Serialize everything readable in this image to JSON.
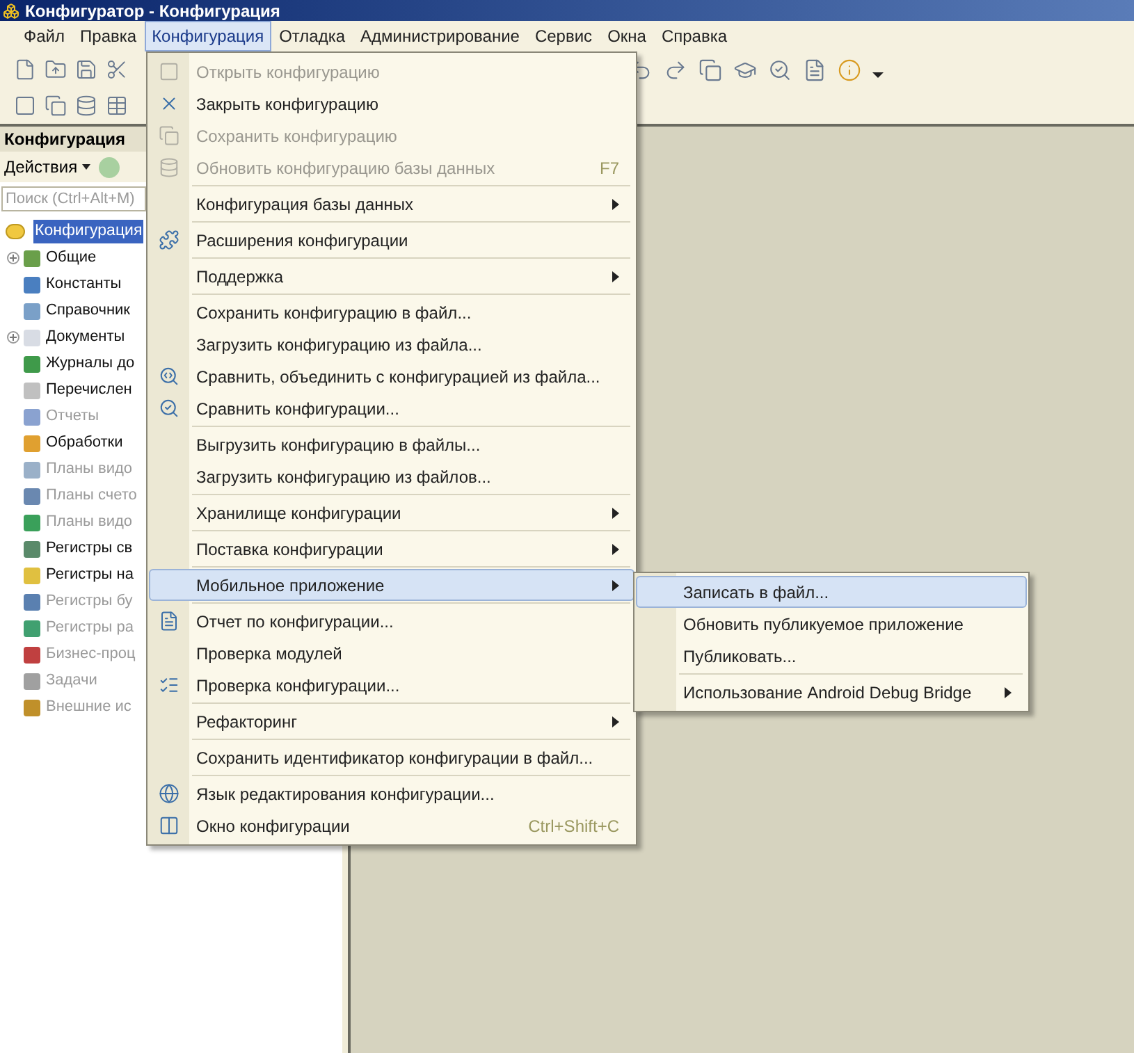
{
  "window": {
    "title": "Конфигуратор - Конфигурация"
  },
  "menubar": [
    {
      "label": "Файл",
      "selected": false
    },
    {
      "label": "Правка",
      "selected": false
    },
    {
      "label": "Конфигурация",
      "selected": true
    },
    {
      "label": "Отладка",
      "selected": false
    },
    {
      "label": "Администрирование",
      "selected": false
    },
    {
      "label": "Сервис",
      "selected": false
    },
    {
      "label": "Окна",
      "selected": false
    },
    {
      "label": "Справка",
      "selected": false
    }
  ],
  "panel": {
    "title": "Конфигурация",
    "actions": "Действия",
    "search": {
      "placeholder": "Поиск (Ctrl+Alt+M)"
    },
    "tree": [
      {
        "label": "Конфигурация",
        "selected": true,
        "children": [
          {
            "label": "Общие",
            "selected": false,
            "disabled": false,
            "expandable": true
          },
          {
            "label": "Константы",
            "selected": false,
            "disabled": false,
            "expandable": false
          },
          {
            "label": "Справочник",
            "selected": false,
            "disabled": false,
            "expandable": false
          },
          {
            "label": "Документы",
            "selected": false,
            "disabled": false,
            "expandable": true
          },
          {
            "label": "Журналы до",
            "selected": false,
            "disabled": false,
            "expandable": false
          },
          {
            "label": "Перечислен",
            "selected": false,
            "disabled": false,
            "expandable": false
          },
          {
            "label": "Отчеты",
            "selected": false,
            "disabled": true,
            "expandable": false
          },
          {
            "label": "Обработки",
            "selected": false,
            "disabled": false,
            "expandable": false
          },
          {
            "label": "Планы видо",
            "selected": false,
            "disabled": true,
            "expandable": false
          },
          {
            "label": "Планы счето",
            "selected": false,
            "disabled": true,
            "expandable": false
          },
          {
            "label": "Планы видо",
            "selected": false,
            "disabled": true,
            "expandable": false
          },
          {
            "label": "Регистры св",
            "selected": false,
            "disabled": false,
            "expandable": false
          },
          {
            "label": "Регистры на",
            "selected": false,
            "disabled": false,
            "expandable": false
          },
          {
            "label": "Регистры бу",
            "selected": false,
            "disabled": true,
            "expandable": false
          },
          {
            "label": "Регистры ра",
            "selected": false,
            "disabled": true,
            "expandable": false
          },
          {
            "label": "Бизнес-проц",
            "selected": false,
            "disabled": true,
            "expandable": false
          },
          {
            "label": "Задачи",
            "selected": false,
            "disabled": true,
            "expandable": false
          },
          {
            "label": "Внешние ис",
            "selected": false,
            "disabled": true,
            "expandable": false
          }
        ]
      }
    ]
  },
  "menu": {
    "groups": [
      [
        {
          "label": "Открыть конфигурацию",
          "disabled": true,
          "submenu": false,
          "selected": false
        },
        {
          "label": "Закрыть конфигурацию",
          "disabled": false,
          "submenu": false,
          "selected": false
        },
        {
          "label": "Сохранить конфигурацию",
          "disabled": true,
          "submenu": false,
          "selected": false
        },
        {
          "label": "Обновить конфигурацию базы данных",
          "shortcut": "F7",
          "disabled": true,
          "submenu": false,
          "selected": false
        }
      ],
      [
        {
          "label": "Конфигурация базы данных",
          "disabled": false,
          "submenu": true,
          "selected": false
        }
      ],
      [
        {
          "label": "Расширения конфигурации",
          "disabled": false,
          "submenu": false,
          "selected": false
        }
      ],
      [
        {
          "label": "Поддержка",
          "disabled": false,
          "submenu": true,
          "selected": false
        }
      ],
      [
        {
          "label": "Сохранить конфигурацию в файл...",
          "disabled": false,
          "submenu": false,
          "selected": false
        },
        {
          "label": "Загрузить конфигурацию из файла...",
          "disabled": false,
          "submenu": false,
          "selected": false
        },
        {
          "label": "Сравнить, объединить с конфигурацией из файла...",
          "disabled": false,
          "submenu": false,
          "selected": false
        },
        {
          "label": "Сравнить конфигурации...",
          "disabled": false,
          "submenu": false,
          "selected": false
        }
      ],
      [
        {
          "label": "Выгрузить конфигурацию в файлы...",
          "disabled": false,
          "submenu": false,
          "selected": false
        },
        {
          "label": "Загрузить конфигурацию из файлов...",
          "disabled": false,
          "submenu": false,
          "selected": false
        }
      ],
      [
        {
          "label": "Хранилище конфигурации",
          "disabled": false,
          "submenu": true,
          "selected": false
        }
      ],
      [
        {
          "label": "Поставка конфигурации",
          "disabled": false,
          "submenu": true,
          "selected": false
        }
      ],
      [
        {
          "label": "Мобильное приложение",
          "disabled": false,
          "submenu": true,
          "selected": true
        }
      ],
      [
        {
          "label": "Отчет по конфигурации...",
          "disabled": false,
          "submenu": false,
          "selected": false
        },
        {
          "label": "Проверка модулей",
          "disabled": false,
          "submenu": false,
          "selected": false
        },
        {
          "label": "Проверка конфигурации...",
          "disabled": false,
          "submenu": false,
          "selected": false
        }
      ],
      [
        {
          "label": "Рефакторинг",
          "disabled": false,
          "submenu": true,
          "selected": false
        }
      ],
      [
        {
          "label": "Сохранить идентификатор конфигурации в файл...",
          "disabled": false,
          "submenu": false,
          "selected": false
        }
      ],
      [
        {
          "label": "Язык редактирования конфигурации...",
          "disabled": false,
          "submenu": false,
          "selected": false
        },
        {
          "label": "Окно конфигурации",
          "shortcut": "Ctrl+Shift+C",
          "disabled": false,
          "submenu": false,
          "selected": false
        }
      ]
    ]
  },
  "submenu": {
    "groups": [
      [
        {
          "label": "Записать в файл...",
          "disabled": false,
          "submenu": false,
          "selected": true
        },
        {
          "label": "Обновить публикуемое приложение",
          "disabled": false,
          "submenu": false,
          "selected": false
        },
        {
          "label": "Публиковать...",
          "disabled": false,
          "submenu": false,
          "selected": false
        }
      ],
      [
        {
          "label": "Использование Android Debug Bridge",
          "disabled": false,
          "submenu": true,
          "selected": false
        }
      ]
    ]
  }
}
